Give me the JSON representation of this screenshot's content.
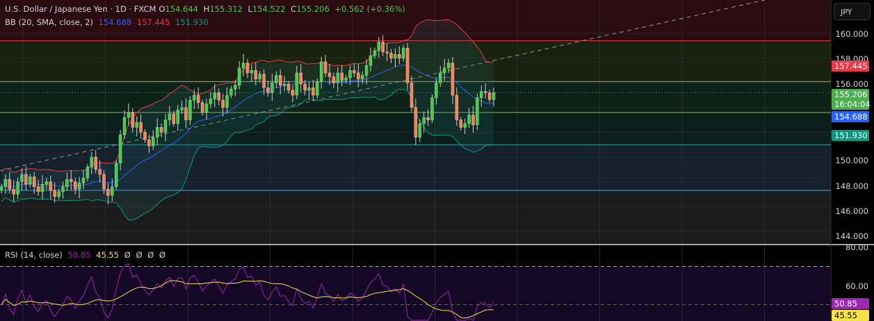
{
  "header": {
    "symbol": "U.S. Dollar / Japanese Yen · 1D · FXCM",
    "o_label": "O",
    "o": "154.644",
    "h_label": "H",
    "h": "155.312",
    "l_label": "L",
    "l": "154.522",
    "c_label": "C",
    "c": "155.206",
    "change": "+0.562 (+0.36%)"
  },
  "bb": {
    "label": "BB (20, SMA, close, 2)",
    "basis": "154.688",
    "upper": "157.445",
    "lower": "151.930"
  },
  "rsi": {
    "label": "RSI (14, close)",
    "value": "50.85",
    "ma": "45.55",
    "extras": [
      "Ø",
      "Ø",
      "Ø",
      "Ø"
    ]
  },
  "currency_button": "JPY",
  "price_axis": [
    "160.000",
    "158.000",
    "156.000",
    "150.000",
    "148.000",
    "146.000",
    "144.000"
  ],
  "rsi_axis": [
    "80.00",
    "60.00"
  ],
  "tags": {
    "upper": "157.445",
    "last": "155.206",
    "countdown": "16:04:04",
    "basis": "154.688",
    "lower": "151.930",
    "rsi": "50.85",
    "rsi_ma": "45.55"
  },
  "colors": {
    "up": "#4cc94c",
    "down": "#f7825a",
    "basis": "#2962ff",
    "upper": "#f23645",
    "lower": "#089981",
    "rsi": "#9c27b0",
    "rsi_ma": "#f5e24a",
    "last": "#4caf50"
  },
  "chart_data": {
    "type": "candlestick",
    "title": "U.S. Dollar / Japanese Yen · 1D · FXCM",
    "ylim": [
      143.5,
      162.5
    ],
    "rsi_ylim": [
      20,
      81
    ],
    "horizontal_levels": [
      {
        "price": 159.4,
        "color": "#f23645"
      },
      {
        "price": 156.1,
        "color": "#8bc34a"
      },
      {
        "price": 153.6,
        "color": "#8bc34a"
      },
      {
        "price": 151.0,
        "color": "#26a69a"
      },
      {
        "price": 147.3,
        "color": "#42a5f5"
      }
    ],
    "trendline": {
      "from": [
        0,
        148.9
      ],
      "to": [
        186,
        163.6
      ]
    },
    "closes": [
      147.6,
      148.2,
      147.4,
      147.0,
      148.0,
      148.6,
      147.8,
      148.4,
      147.6,
      147.2,
      147.8,
      148.0,
      147.3,
      146.8,
      147.2,
      147.6,
      148.2,
      148.0,
      147.4,
      147.9,
      148.3,
      149.2,
      150.0,
      149.0,
      148.6,
      147.4,
      146.9,
      147.6,
      149.5,
      151.8,
      153.2,
      153.6,
      152.4,
      152.8,
      152.0,
      151.4,
      150.9,
      151.6,
      152.4,
      152.0,
      153.0,
      153.5,
      152.7,
      153.8,
      154.0,
      153.0,
      154.6,
      155.0,
      154.4,
      153.6,
      154.3,
      154.7,
      155.2,
      154.6,
      154.0,
      155.0,
      155.5,
      155.8,
      157.2,
      157.6,
      156.8,
      157.0,
      156.3,
      156.7,
      155.6,
      155.2,
      156.0,
      156.6,
      155.8,
      155.9,
      155.4,
      155.0,
      156.8,
      155.9,
      155.4,
      155.6,
      155.0,
      156.1,
      157.7,
      156.8,
      156.5,
      156.0,
      156.8,
      156.2,
      156.4,
      157.0,
      156.8,
      156.3,
      156.6,
      157.4,
      158.2,
      158.6,
      159.3,
      158.5,
      158.4,
      158.0,
      158.3,
      158.0,
      158.8,
      156.0,
      154.0,
      151.6,
      152.7,
      153.2,
      153.0,
      154.8,
      156.0,
      156.8,
      157.2,
      157.6,
      155.0,
      153.0,
      152.4,
      152.7,
      153.4,
      152.6,
      154.8,
      155.3,
      155.2,
      154.644,
      155.206
    ]
  }
}
